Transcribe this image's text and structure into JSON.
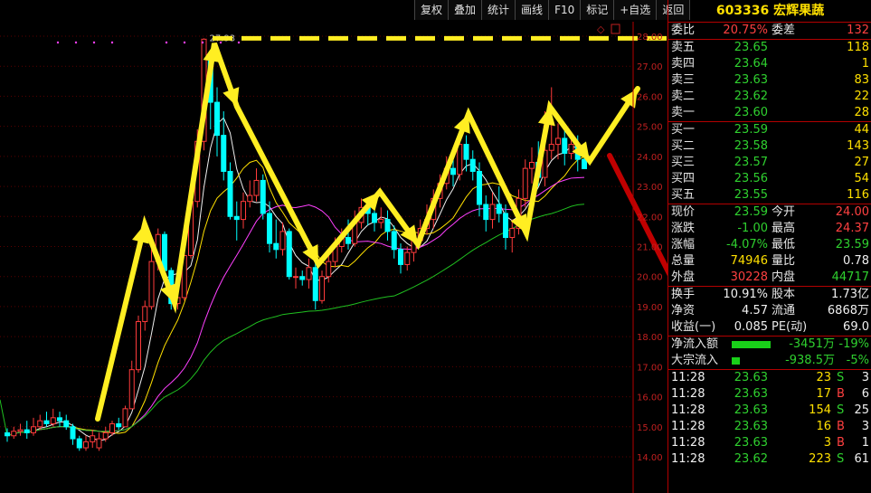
{
  "toolbar": {
    "buttons": [
      "复权",
      "叠加",
      "统计",
      "画线",
      "F10",
      "标记",
      "+自选",
      "返回"
    ]
  },
  "chart": {
    "y_ticks": [
      "28.00",
      "27.00",
      "26.00",
      "25.00",
      "24.00",
      "23.00",
      "22.00",
      "21.00",
      "20.00",
      "19.00",
      "18.00",
      "17.00",
      "16.00",
      "15.00",
      "14.00"
    ],
    "high_marker": "27.93"
  },
  "chart_data": {
    "type": "candlestick",
    "y_range": [
      13.5,
      28.5
    ],
    "high_label": 27.93,
    "last_price": 23.59
  },
  "panel": {
    "title": "603336 宏辉果蔬",
    "weibi": {
      "label": "委比",
      "value": "20.75%",
      "label2": "委差",
      "value2": "132"
    },
    "asks": [
      {
        "label": "卖五",
        "price": "23.65",
        "vol": "118"
      },
      {
        "label": "卖四",
        "price": "23.64",
        "vol": "1"
      },
      {
        "label": "卖三",
        "price": "23.63",
        "vol": "83"
      },
      {
        "label": "卖二",
        "price": "23.62",
        "vol": "22"
      },
      {
        "label": "卖一",
        "price": "23.60",
        "vol": "28"
      }
    ],
    "bids": [
      {
        "label": "买一",
        "price": "23.59",
        "vol": "44"
      },
      {
        "label": "买二",
        "price": "23.58",
        "vol": "143"
      },
      {
        "label": "买三",
        "price": "23.57",
        "vol": "27"
      },
      {
        "label": "买四",
        "price": "23.56",
        "vol": "54"
      },
      {
        "label": "买五",
        "price": "23.55",
        "vol": "116"
      }
    ],
    "quote": [
      {
        "l1": "现价",
        "v1": "23.59",
        "l2": "今开",
        "v2": "24.00"
      },
      {
        "l1": "涨跌",
        "v1": "-1.00",
        "l2": "最高",
        "v2": "24.37"
      },
      {
        "l1": "涨幅",
        "v1": "-4.07%",
        "l2": "最低",
        "v2": "23.59"
      },
      {
        "l1": "总量",
        "v1": "74946",
        "l2": "量比",
        "v2": "0.78"
      },
      {
        "l1": "外盘",
        "v1": "30228",
        "l2": "内盘",
        "v2": "44717"
      }
    ],
    "stats": [
      {
        "l1": "换手",
        "v1": "10.91%",
        "l2": "股本",
        "v2": "1.73亿"
      },
      {
        "l1": "净资",
        "v1": "4.57",
        "l2": "流通",
        "v2": "6868万"
      },
      {
        "l1": "收益(一)",
        "v1": "0.085",
        "l2": "PE(动)",
        "v2": "69.0"
      }
    ],
    "flows": [
      {
        "label": "净流入额",
        "bar": 0.9,
        "amount": "-3451万",
        "pct": "-19%"
      },
      {
        "label": "大宗流入",
        "bar": 0.18,
        "amount": "-938.5万",
        "pct": "-5%"
      }
    ],
    "ticks": [
      {
        "time": "11:28",
        "price": "23.63",
        "vol": "23",
        "side": "S",
        "num": "3"
      },
      {
        "time": "11:28",
        "price": "23.63",
        "vol": "17",
        "side": "B",
        "num": "6"
      },
      {
        "time": "11:28",
        "price": "23.63",
        "vol": "154",
        "side": "S",
        "num": "25"
      },
      {
        "time": "11:28",
        "price": "23.63",
        "vol": "16",
        "side": "B",
        "num": "3"
      },
      {
        "time": "11:28",
        "price": "23.63",
        "vol": "3",
        "side": "B",
        "num": "1"
      },
      {
        "time": "11:28",
        "price": "23.62",
        "vol": "223",
        "side": "S",
        "num": "61"
      }
    ]
  }
}
